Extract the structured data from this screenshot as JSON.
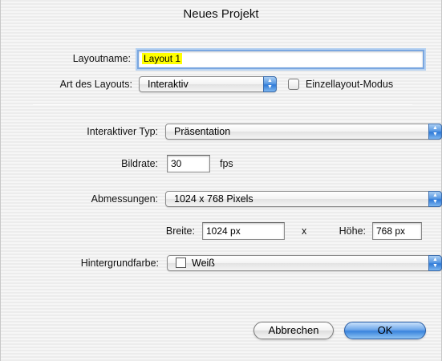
{
  "dialog": {
    "title": "Neues Projekt"
  },
  "layout": {
    "name_label": "Layoutname:",
    "name_value": "Layout 1",
    "type_label": "Art des Layouts:",
    "type_value": "Interaktiv",
    "single_layout_label": "Einzellayout-Modus",
    "single_layout_checked": false
  },
  "interactive": {
    "type_label": "Interaktiver Typ:",
    "type_value": "Präsentation",
    "framerate_label": "Bildrate:",
    "framerate_value": "30",
    "framerate_unit": "fps"
  },
  "dimensions": {
    "label": "Abmessungen:",
    "value": "1024 x 768 Pixels",
    "width_label": "Breite:",
    "width_value": "1024 px",
    "times": "x",
    "height_label": "Höhe:",
    "height_value": "768 px"
  },
  "background": {
    "label": "Hintergrundfarbe:",
    "value": "Weiß",
    "color": "#ffffff"
  },
  "buttons": {
    "cancel_label": "Abbrechen",
    "ok_label": "OK"
  }
}
